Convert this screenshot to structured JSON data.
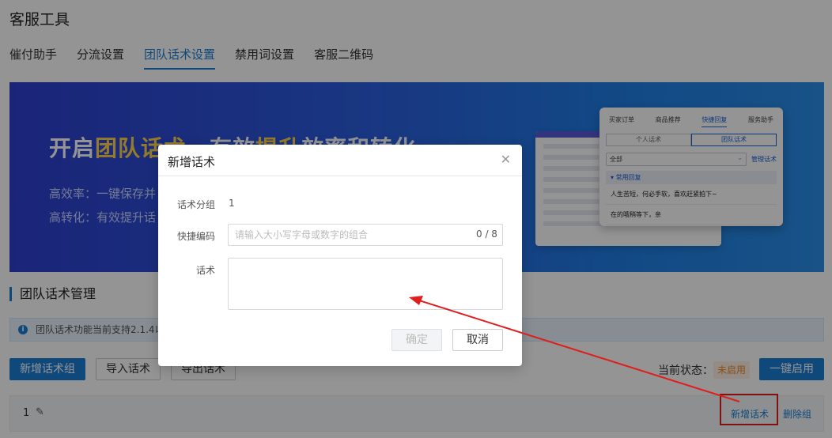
{
  "page": {
    "title": "客服工具"
  },
  "tabs": [
    "催付助手",
    "分流设置",
    "团队话术设置",
    "禁用词设置",
    "客服二维码"
  ],
  "banner": {
    "headline_pre": "开启",
    "headline_hl1": "团队话术",
    "headline_mid": "，有效",
    "headline_hl2": "提升",
    "headline_post": "效率和转化",
    "line1": "高效率：一键保存并",
    "line2": "高转化：有效提升话",
    "panel": {
      "tabs": [
        "买家订单",
        "商品推荐",
        "快捷回复",
        "服务助手"
      ],
      "segments": [
        "个人话术",
        "团队话术"
      ],
      "select_value": "全部",
      "manage": "管理话术",
      "group": "常用回复",
      "items": [
        "人生苦短，何必手软，喜欢赶紧拍下~",
        "在的哦稍等下，亲"
      ]
    }
  },
  "section": {
    "title": "团队话术管理",
    "notice": "团队话术功能当前支持2.1.4以"
  },
  "toolbar": {
    "add_group": "新增话术组",
    "import": "导入话术",
    "export": "导出话术",
    "state_label": "当前状态：",
    "state_value": "未启用",
    "enable": "一键启用"
  },
  "group_row": {
    "name": "1",
    "add_script": "新增话术",
    "delete_group": "删除组"
  },
  "dialog": {
    "title": "新增话术",
    "group_label": "话术分组",
    "group_value": "1",
    "code_label": "快捷编码",
    "code_placeholder": "请输入大小写字母或数字的组合",
    "code_count": "0 / 8",
    "script_label": "话术",
    "script_value": "",
    "confirm": "确定",
    "cancel": "取消"
  },
  "colors": {
    "accent": "#1a7fd6",
    "annotation": "#e01e1e",
    "warning": "#e8892b"
  }
}
